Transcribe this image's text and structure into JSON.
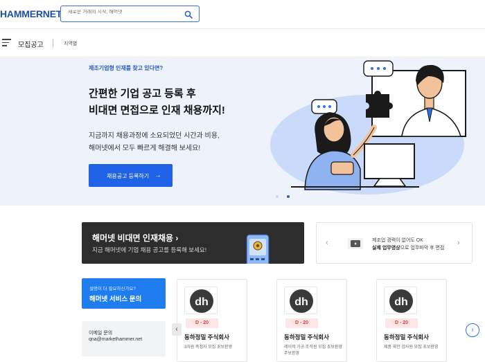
{
  "header": {
    "logo": "HAMMERNET",
    "search_placeholder": "새로운 거래의 시작, 해머넷"
  },
  "subnav": {
    "title": "모집공고",
    "region": "지역별"
  },
  "hero": {
    "eyebrow": "제조기업형 인재를 찾고 있다면?",
    "headline_1": "간편한 기업 공고 등록 후",
    "headline_2": "비대면 면접으로 인재 채용까지!",
    "desc_1": "지금까지 채용과정에 소요되었던 시간과 비용,",
    "desc_2": "해머넷에서 모두 빠르게 해결해 보세요!",
    "cta_label": "채용공고 등록하기",
    "cta_arrow": "→",
    "slide_count": 2,
    "active_slide": 2
  },
  "banner": {
    "title": "해머넷 비대면 인재채용  ›",
    "subtitle": "지금 해머넷에 기업 채용 공고를 등록해 보세요!"
  },
  "promo": {
    "line_1": "제조업 경력이 없어도 OK",
    "line_2_bold": "실제 업무영상",
    "line_2_rest": "으로 업무파악 후 면접",
    "prev": "‹",
    "next": "›"
  },
  "service": {
    "small": "설명이 더 필요하신가요?",
    "title": "해머넷 서비스 문의"
  },
  "mail": {
    "label": "이메일 문의",
    "address": "qna@markethammer.net"
  },
  "cards": [
    {
      "dday": "D - 20",
      "company": "동하정밀 주식회사",
      "desc": "3차원 측정자 모집 초보환영"
    },
    {
      "dday": "D - 20",
      "company": "동하정밀 주식회사",
      "desc": "레이저 가공 조작원 모집 초보환영 주보환영"
    },
    {
      "dday": "D - 20",
      "company": "동하정밀 주식회사",
      "desc": "제품 육안 검사원 모집 초보환영"
    }
  ],
  "carousel": {
    "prev": "‹",
    "next": "›"
  },
  "colors": {
    "brand": "#1f4ea8",
    "accent": "#1f62e6",
    "dday": "#e23b3b",
    "hero_bg": "#eef3fb"
  }
}
